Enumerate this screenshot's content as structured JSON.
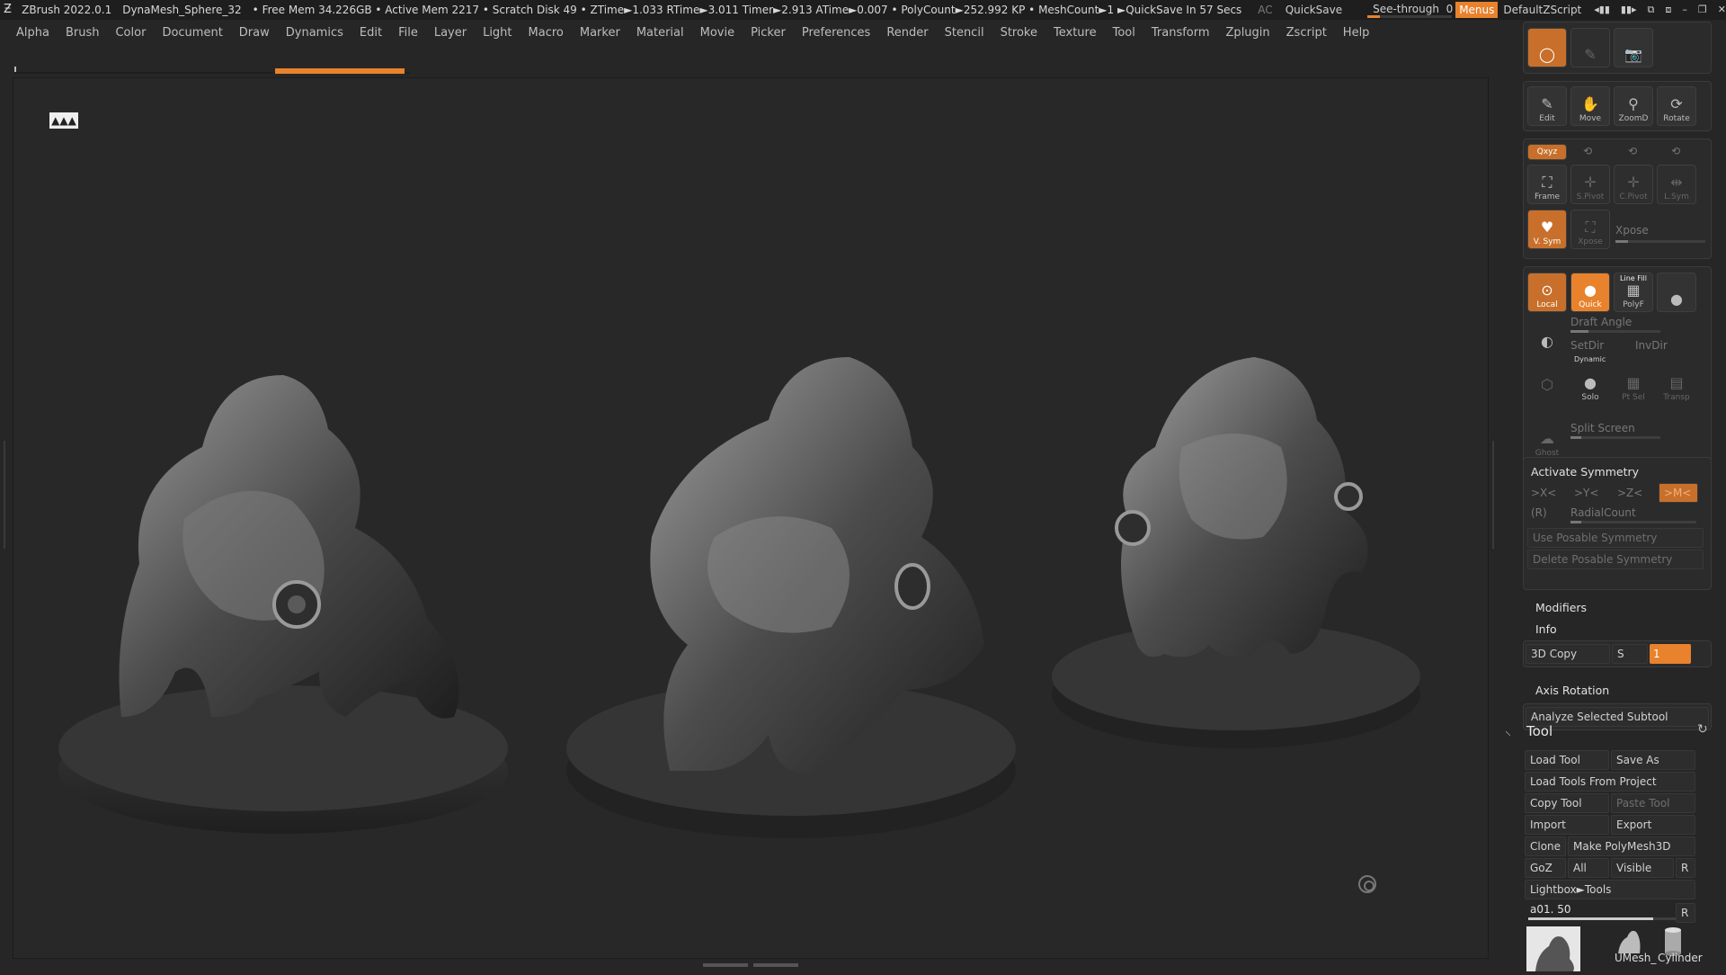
{
  "titlebar": {
    "app": "ZBrush 2022.0.1",
    "document": "DynaMesh_Sphere_32",
    "stats": "• Free Mem 34.226GB • Active Mem 2217 • Scratch Disk 49 •  ZTime►1.033 RTime►3.011 Timer►2.913 ATime►0.007 • PolyCount►252.992 KP  • MeshCount►1  ►QuickSave In 57 Secs",
    "ac": "AC",
    "quicksave": "QuickSave",
    "see_through_label": "See-through",
    "see_through_value": "0",
    "see_through_level": 0,
    "menus": "Menus",
    "default_zscript": "DefaultZScript",
    "accent": "#e8822d"
  },
  "menubar": [
    "Alpha",
    "Brush",
    "Color",
    "Document",
    "Draw",
    "Dynamics",
    "Edit",
    "File",
    "Layer",
    "Light",
    "Macro",
    "Marker",
    "Material",
    "Movie",
    "Picker",
    "Preferences",
    "Render",
    "Stencil",
    "Stroke",
    "Texture",
    "Tool",
    "Transform",
    "Zplugin",
    "Zscript",
    "Help"
  ],
  "right_panel": {
    "nav_buttons": [
      "Edit",
      "Move",
      "ZoomD",
      "Rotate"
    ],
    "xyz": "Qxyz",
    "frame": "Frame",
    "spivot": "S.Pivot",
    "cpivot": "C.Pivot",
    "lsym": "L.Sym",
    "vsym": "V. Sym",
    "xpose_icon": "Xpose",
    "xpose": "Xpose",
    "local": "Local",
    "quick": "Quick",
    "line_fill": "Line Fill",
    "polyf": "PolyF",
    "draft_angle": "Draft Angle",
    "setdir": "SetDir",
    "invdir": "InvDir",
    "dynamic": "Dynamic",
    "solo": "Solo",
    "ptsel": "Pt Sel",
    "transp": "Transp",
    "ghost": "Ghost",
    "split_screen": "Split Screen",
    "activate_symmetry": "Activate Symmetry",
    "x_axis": ">X<",
    "y_axis": ">Y<",
    "z_axis": ">Z<",
    "m_axis": ">M<",
    "r": "(R)",
    "radial_count": "RadialCount",
    "use_posable": "Use Posable Symmetry",
    "delete_posable": "Delete Posable Symmetry",
    "modifiers": "Modifiers",
    "info": "Info",
    "copy3d": "3D Copy",
    "s": "S",
    "copy3d_value": "1",
    "axis_rotation": "Axis Rotation",
    "analyze_subtool": "Analyze Selected Subtool"
  },
  "tool_panel": {
    "title": "Tool",
    "load_tool": "Load Tool",
    "save_as": "Save As",
    "load_from_project": "Load Tools From Project",
    "copy_tool": "Copy Tool",
    "paste_tool": "Paste Tool",
    "import": "Import",
    "export": "Export",
    "clone": "Clone",
    "make_polymesh": "Make PolyMesh3D",
    "goz": "GoZ",
    "all": "All",
    "visible": "Visible",
    "r": "R",
    "lightbox_tools": "Lightbox►Tools",
    "current_tool": "a01. 50",
    "tool_slider_level": 0.85,
    "umesh": "UMesh_",
    "cylinder": "Cylinder"
  }
}
